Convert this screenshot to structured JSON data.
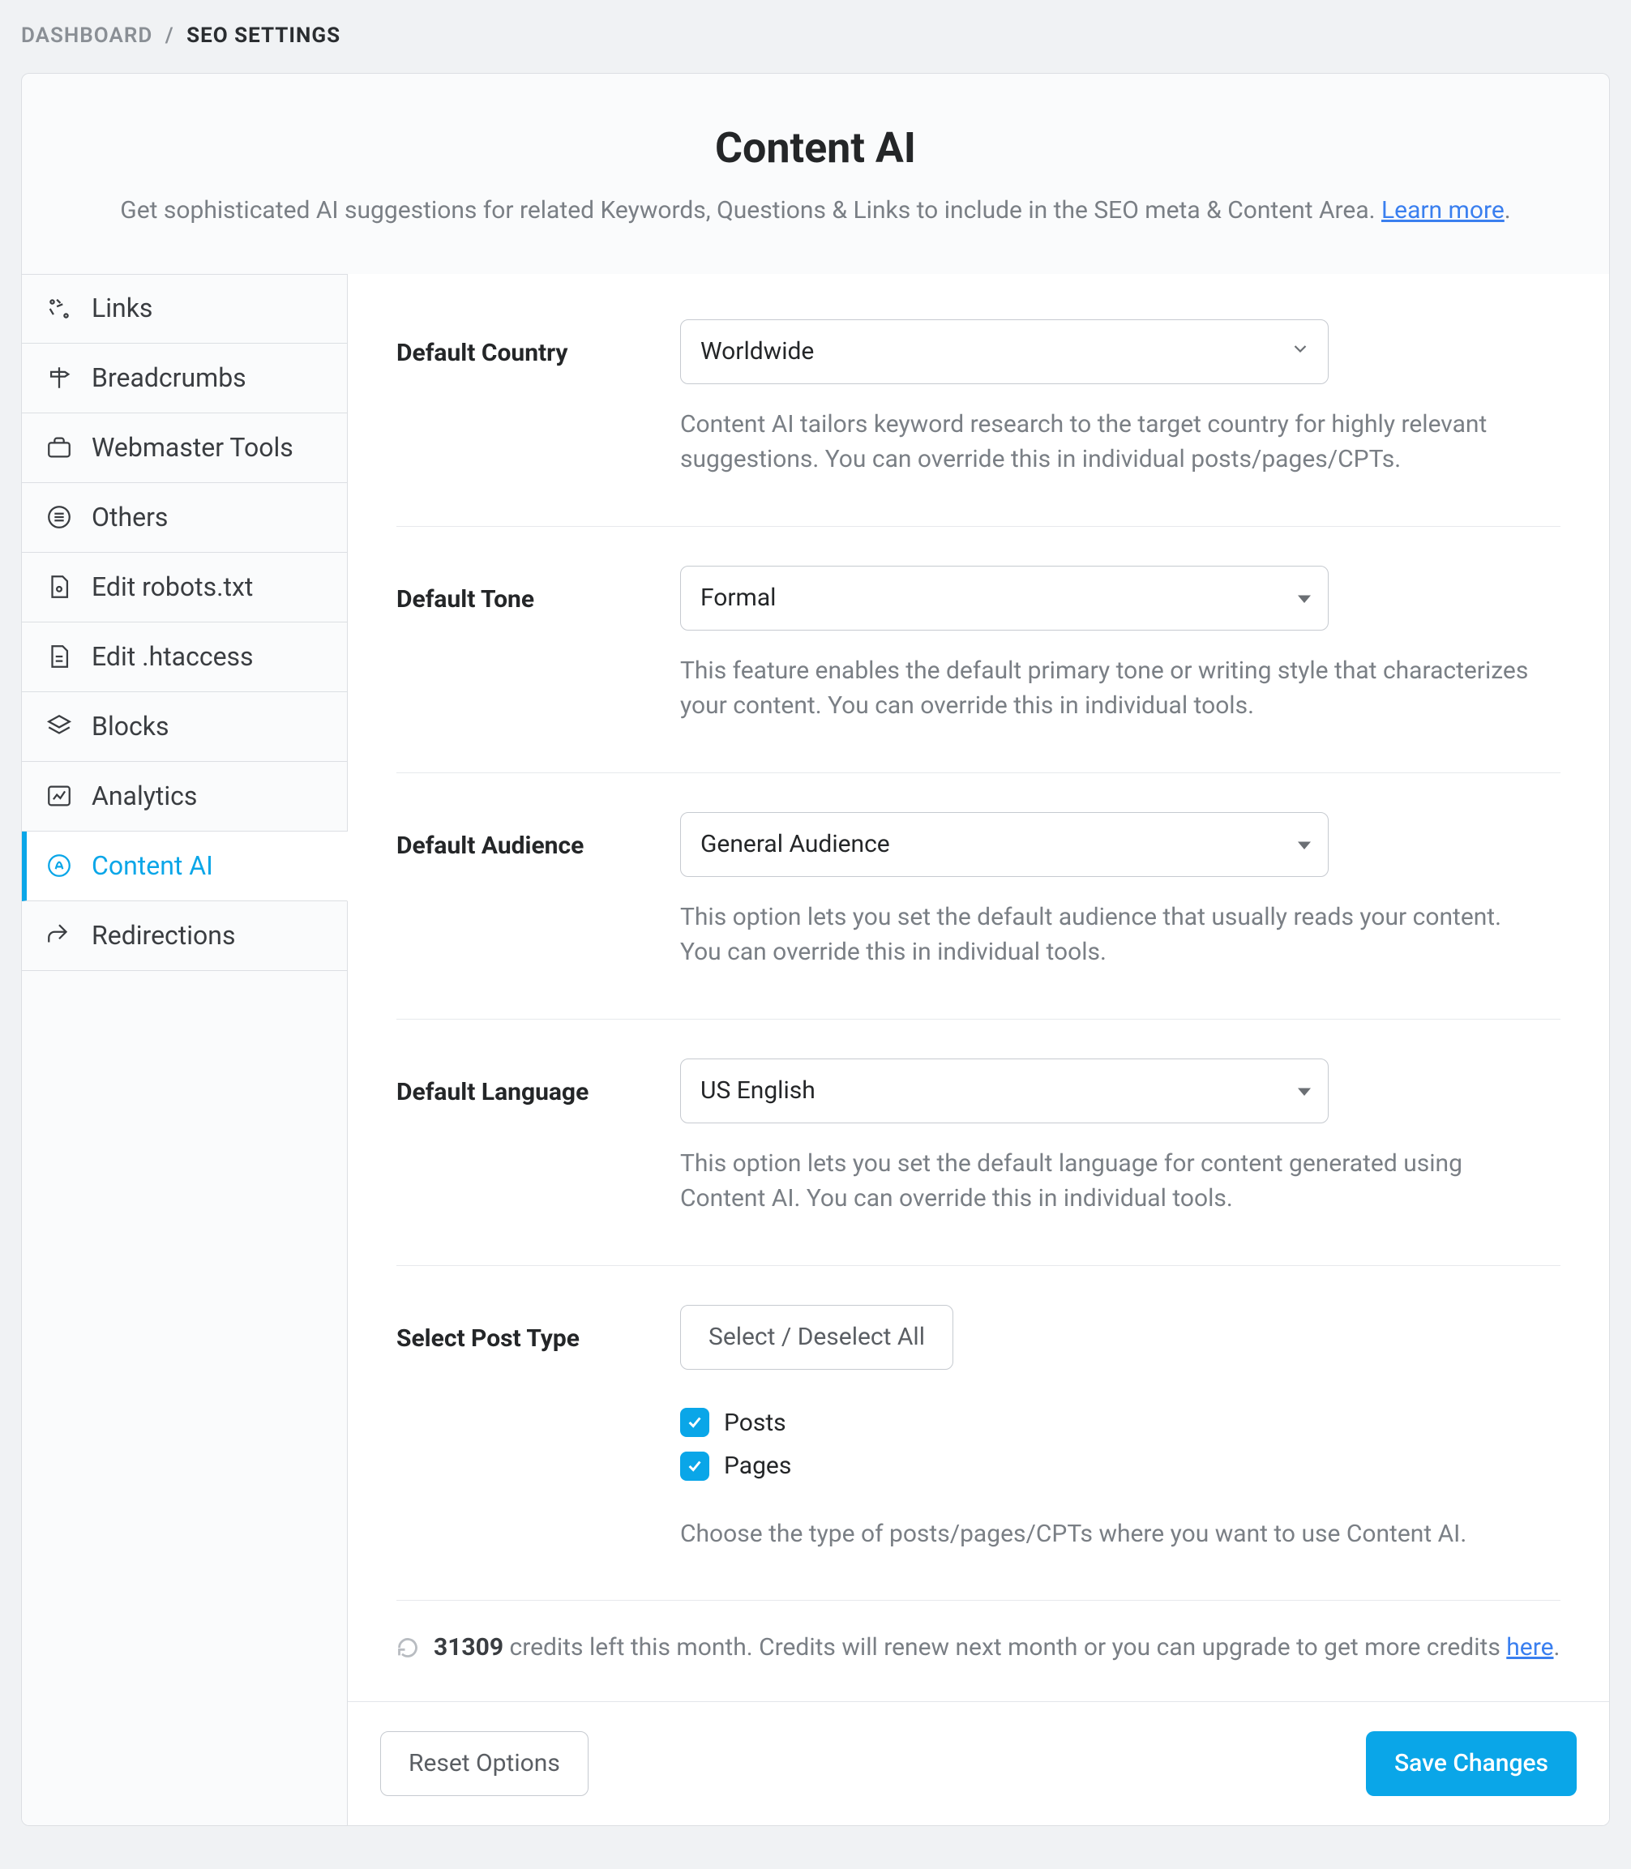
{
  "breadcrumb": {
    "parent": "DASHBOARD",
    "sep": "/",
    "current": "SEO SETTINGS"
  },
  "header": {
    "title": "Content AI",
    "subtitle_pre": "Get sophisticated AI suggestions for related Keywords, Questions & Links to include in the SEO meta & Content Area. ",
    "learn_more": "Learn more",
    "subtitle_post": "."
  },
  "sidebar": {
    "items": [
      {
        "label": "Links"
      },
      {
        "label": "Breadcrumbs"
      },
      {
        "label": "Webmaster Tools"
      },
      {
        "label": "Others"
      },
      {
        "label": "Edit robots.txt"
      },
      {
        "label": "Edit .htaccess"
      },
      {
        "label": "Blocks"
      },
      {
        "label": "Analytics"
      },
      {
        "label": "Content AI"
      },
      {
        "label": "Redirections"
      }
    ]
  },
  "fields": {
    "country": {
      "label": "Default Country",
      "value": "Worldwide",
      "help": "Content AI tailors keyword research to the target country for highly relevant suggestions. You can override this in individual posts/pages/CPTs."
    },
    "tone": {
      "label": "Default Tone",
      "value": "Formal",
      "help": "This feature enables the default primary tone or writing style that characterizes your content. You can override this in individual tools."
    },
    "audience": {
      "label": "Default Audience",
      "value": "General Audience",
      "help": "This option lets you set the default audience that usually reads your content. You can override this in individual tools."
    },
    "language": {
      "label": "Default Language",
      "value": "US English",
      "help": "This option lets you set the default language for content generated using Content AI. You can override this in individual tools."
    },
    "post_type": {
      "label": "Select Post Type",
      "toggle_all": "Select / Deselect All",
      "options": [
        {
          "label": "Posts",
          "checked": true
        },
        {
          "label": "Pages",
          "checked": true
        }
      ],
      "help": "Choose the type of posts/pages/CPTs where you want to use Content AI."
    }
  },
  "credits": {
    "count": "31309",
    "text_a": " credits left this month. Credits will renew next month or you can upgrade to get more credits ",
    "here": "here",
    "text_b": "."
  },
  "footer": {
    "reset": "Reset Options",
    "save": "Save Changes"
  }
}
